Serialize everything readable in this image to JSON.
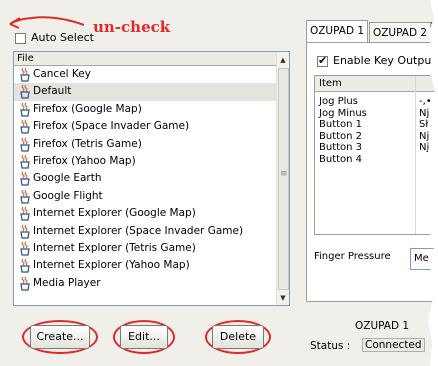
{
  "annotation": {
    "text": "un-check"
  },
  "auto_select": {
    "label": "Auto Select",
    "checked": false
  },
  "file_list": {
    "header": "File",
    "items": [
      "Cancel Key",
      "Default",
      "Firefox (Google Map)",
      "Firefox (Space Invader Game)",
      "Firefox (Tetris Game)",
      "Firefox (Yahoo Map)",
      "Google Earth",
      "Google Flight",
      "Internet Explorer (Google Map)",
      "Internet Explorer (Space Invader Game)",
      "Internet Explorer (Tetris Game)",
      "Internet Explorer (Yahoo Map)",
      "Media Player"
    ],
    "selected": "Default",
    "scroll_up": "▲",
    "scroll_down": "▼",
    "thumb_grip": "≡"
  },
  "buttons": {
    "create": "Create...",
    "edit": "Edit...",
    "delete": "Delete"
  },
  "tabs": [
    "OZUPAD 1",
    "OZUPAD 2"
  ],
  "tab_overflow": "¹",
  "enable_key_output": {
    "label": "Enable Key Output",
    "checked": true
  },
  "item_table": {
    "header": "Item",
    "rows": [
      {
        "item": "Jog Plus",
        "value": "-,•"
      },
      {
        "item": "Jog Minus",
        "value": "Nj"
      },
      {
        "item": "Button 1",
        "value": "Sł"
      },
      {
        "item": "Button 2",
        "value": "Nj"
      },
      {
        "item": "Button 3",
        "value": "Nj"
      },
      {
        "item": "Button 4",
        "value": ""
      }
    ]
  },
  "finger_pressure": {
    "label": "Finger Pressure",
    "value": "Me"
  },
  "status": {
    "device": "OZUPAD 1",
    "label": "Status :",
    "value": "Connected"
  },
  "colors": {
    "annotation_red": "#e02a2a",
    "selection": "#e4e3dd",
    "list_border": "#7f9db9"
  },
  "icons": {
    "file_item": "java-cup-icon",
    "annotation_arrow": "red-arrow-icon"
  }
}
